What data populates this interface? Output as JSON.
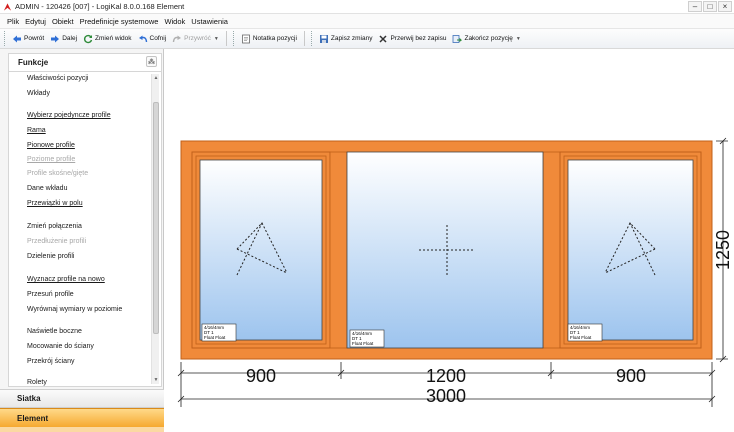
{
  "window": {
    "title": "ADMIN - 120426 [007] - LogiKal 8.0.0.168 Element",
    "controls": {
      "minimize": "–",
      "maximize": "□",
      "close": "×"
    }
  },
  "menu": [
    {
      "label": "Plik"
    },
    {
      "label": "Edytuj"
    },
    {
      "label": "Obiekt"
    },
    {
      "label": "Predefinicje systemowe"
    },
    {
      "label": "Widok"
    },
    {
      "label": "Ustawienia"
    }
  ],
  "toolbar": {
    "back": "Powrót",
    "next": "Dalej",
    "change_view": "Zmień widok",
    "undo": "Cofnij",
    "redo": "Przywróć",
    "note": "Notatka pozycji",
    "save_changes": "Zapisz zmiany",
    "abort_no_save": "Przerwij bez zapisu",
    "finish_position": "Zakończ pozycję"
  },
  "panel": {
    "title": "Funkcje",
    "items": [
      {
        "label": "Właściwości pozycji",
        "enabled": true
      },
      {
        "label": "Wkłady",
        "enabled": true
      },
      {
        "label": "Wybierz pojedyncze profile",
        "enabled": true
      },
      {
        "label": "Rama",
        "enabled": true
      },
      {
        "label": "Pionowe profile",
        "enabled": true
      },
      {
        "label": "Poziome profile",
        "enabled": false
      },
      {
        "label": "Profile skośne/gięte",
        "enabled": false
      },
      {
        "label": "Dane wkładu",
        "enabled": true
      },
      {
        "label": "Przewiązki w polu",
        "enabled": true
      },
      {
        "label": "Zmień połączenia",
        "enabled": true
      },
      {
        "label": "Przedłużenie profili",
        "enabled": false
      },
      {
        "label": "Dzielenie profili",
        "enabled": true
      },
      {
        "label": "Wyznacz profile na nowo",
        "enabled": true
      },
      {
        "label": "Przesuń profile",
        "enabled": true
      },
      {
        "label": "Wyrównaj wymiary w poziomie",
        "enabled": true
      },
      {
        "label": "Naświetle boczne",
        "enabled": true
      },
      {
        "label": "Mocowanie do ściany",
        "enabled": true
      },
      {
        "label": "Przekrój ściany",
        "enabled": true
      },
      {
        "label": "Rolety",
        "enabled": true
      }
    ],
    "sections": {
      "grid": "Siatka",
      "element": "Element"
    }
  },
  "drawing": {
    "dimensions": {
      "left_width": "900",
      "middle_width": "1200",
      "right_width": "900",
      "total_width": "3000",
      "height": "1250"
    },
    "glass_label": {
      "line1": "4/16/4mm",
      "line2": "DT 1",
      "line3": "Float Float"
    },
    "colors": {
      "frame": "#f08a3a",
      "frame_dark": "#c0601a",
      "glass_top": "#ffffff",
      "glass_bottom": "#9dc4ee"
    }
  }
}
